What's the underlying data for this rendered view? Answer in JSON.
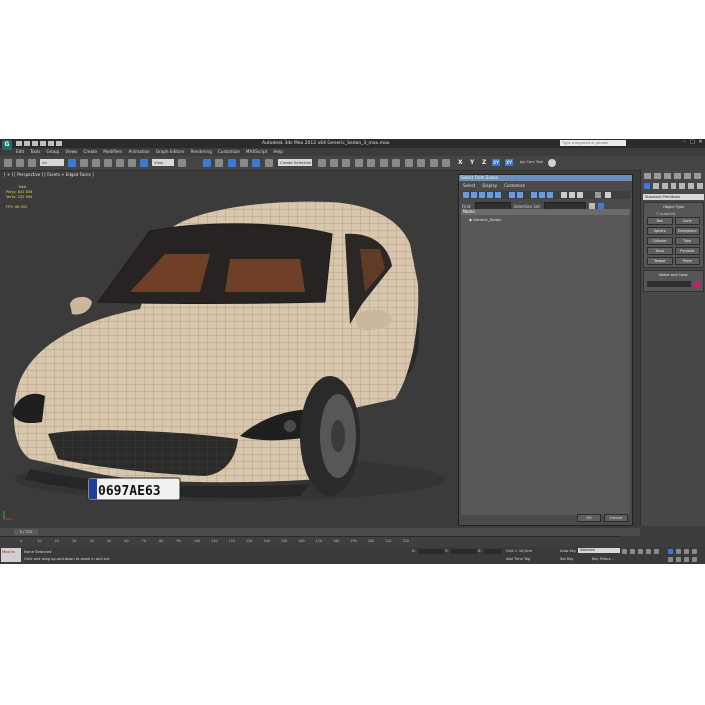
{
  "window": {
    "title": "Autodesk 3ds Max  2012 x64     Generic_Sedan_3_max.max",
    "search_placeholder": "Type a keyword or phrase",
    "win_controls": [
      "–",
      "□",
      "✕"
    ]
  },
  "menu": [
    "Edit",
    "Tools",
    "Group",
    "Views",
    "Create",
    "Modifiers",
    "Animation",
    "Graph Editors",
    "Rendering",
    "Customize",
    "MAXScript",
    "Help"
  ],
  "toolbar": {
    "filter_label": "All",
    "view_label": "View",
    "selection_set": "Create Selection S",
    "axes": [
      "X",
      "Y",
      "Z",
      "XY",
      "XY"
    ],
    "cam_tool": "Joy Cam Tool"
  },
  "viewport": {
    "label": "[ + ] [ Perspective ] [ Facets + Edged Faces ]",
    "stats_title": "Total",
    "polys_label": "Polys:",
    "polys_value": "822 836",
    "verts_label": "Verts:",
    "verts_value": "232 964",
    "fps_label": "FPS:",
    "fps_value": "86.352",
    "plate_text": "0697AE63"
  },
  "scene_explorer": {
    "title": "Select From Scene",
    "menu": [
      "Select",
      "Display",
      "Customize"
    ],
    "find_label": "Find:",
    "selection_set_label": "Selection Set:",
    "column_header": "Name",
    "items": [
      "Generic_Sedan"
    ],
    "ok": "OK",
    "cancel": "Cancel"
  },
  "command_panel": {
    "category": "Standard Primitives",
    "object_type_title": "Object Type",
    "autogrid": "AutoGrid",
    "primitives": [
      "Box",
      "Cone",
      "Sphere",
      "GeoSphere",
      "Cylinder",
      "Tube",
      "Torus",
      "Pyramid",
      "Teapot",
      "Plane"
    ],
    "name_color_title": "Name and Color",
    "object_color": "#c0226a"
  },
  "timeline": {
    "slider_text": "0 / 225",
    "ticks": [
      "0",
      "10",
      "20",
      "30",
      "40",
      "50",
      "60",
      "70",
      "80",
      "90",
      "100",
      "110",
      "120",
      "130",
      "140",
      "150",
      "160",
      "170",
      "180",
      "190",
      "200",
      "210",
      "220"
    ]
  },
  "status": {
    "maxscript_mini": "Max to",
    "prompt1": "None Selected",
    "prompt2": "Click and drag up-and-down to zoom in and out",
    "x_label": "X:",
    "y_label": "Y:",
    "z_label": "Z:",
    "grid": "Grid = 10,0cm",
    "auto_key": "Auto Key",
    "auto_key_value": "Selected",
    "set_key": "Set Key",
    "key_filters": "Key Filters...",
    "add_time_tag": "Add Time Tag"
  }
}
